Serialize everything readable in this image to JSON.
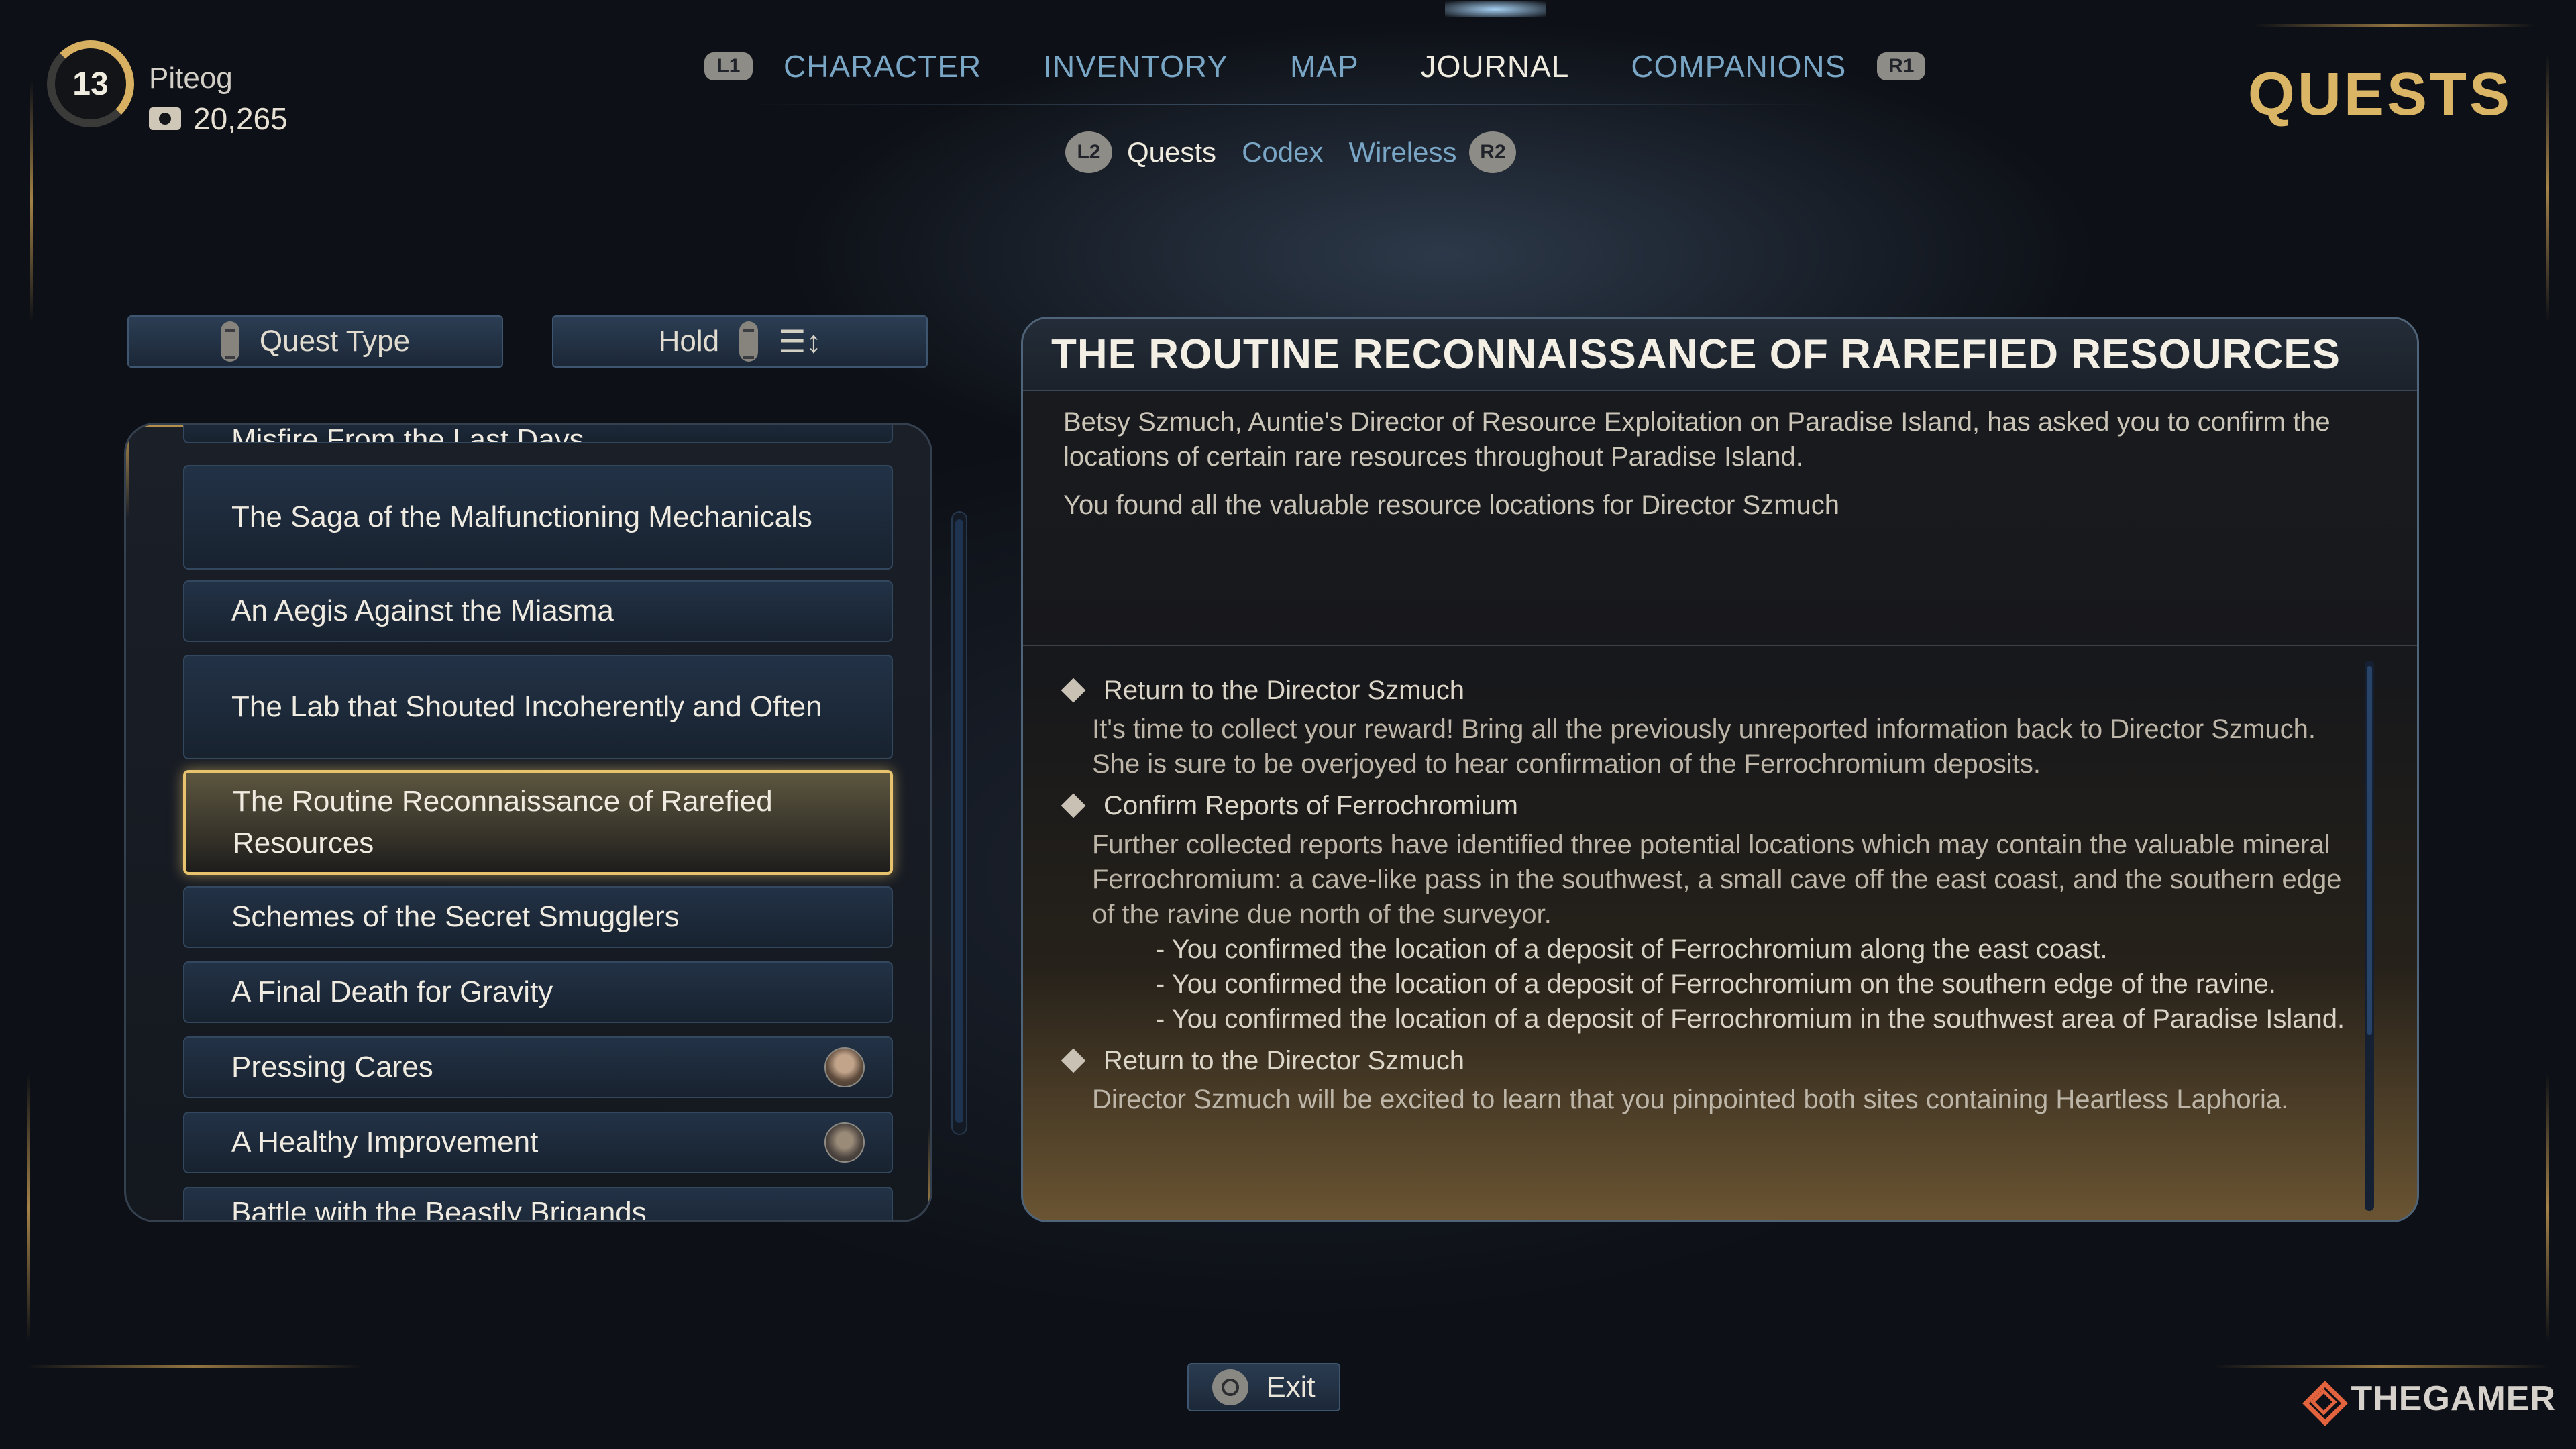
{
  "player": {
    "level": "13",
    "name": "Piteog",
    "credits": "20,265"
  },
  "nav": {
    "left_hint": "L1",
    "right_hint": "R1",
    "tabs": [
      "CHARACTER",
      "INVENTORY",
      "MAP",
      "JOURNAL",
      "COMPANIONS"
    ],
    "active_tab": "JOURNAL"
  },
  "subnav": {
    "left_hint": "L2",
    "right_hint": "R2",
    "tabs": [
      "Quests",
      "Codex",
      "Wireless"
    ],
    "active_tab": "Quests"
  },
  "page_title": "QUESTS",
  "filters": {
    "quest_type_label": "Quest Type",
    "hold_label": "Hold"
  },
  "quest_list": {
    "items": [
      "Misfire From the Last Days",
      "The Saga of the Malfunctioning Mechanicals",
      "An Aegis Against the Miasma",
      "The Lab that Shouted Incoherently and Often",
      "The Routine Reconnaissance of Rarefied Resources",
      "Schemes of the Secret Smugglers",
      "A Final Death for Gravity",
      "Pressing Cares",
      "A Healthy Improvement",
      "Battle with the Beastly Brigands"
    ],
    "selected_index": 4
  },
  "detail": {
    "title": "THE ROUTINE RECONNAISSANCE OF RAREFIED RESOURCES",
    "summary": "Betsy Szmuch, Auntie's Director of Resource Exploitation on Paradise Island, has asked you to confirm the locations of certain rare resources throughout Paradise Island.",
    "progress": "You found all the valuable resource locations for Director Szmuch",
    "objectives": [
      {
        "title": "Return to the Director Szmuch",
        "description": "It's time to collect your reward! Bring all the previously unreported information back to Director Szmuch. She is sure to be overjoyed to hear confirmation of the Ferrochromium deposits."
      },
      {
        "title": "Confirm Reports of Ferrochromium",
        "description": "Further collected reports have identified three potential locations which may contain the valuable mineral Ferrochromium: a cave-like pass in the southwest, a small cave off the east coast, and the southern edge of the ravine due north of the surveyor.",
        "sub": [
          "- You confirmed the location of a deposit of Ferrochromium along the east coast.",
          "- You confirmed the location of a deposit of Ferrochromium on the southern edge of the ravine.",
          "- You confirmed the location of a deposit of Ferrochromium in the southwest area of Paradise Island."
        ]
      },
      {
        "title": "Return to the Director Szmuch",
        "description": "Director Szmuch will be excited to learn that you pinpointed both sites containing Heartless Laphoria."
      }
    ]
  },
  "footer": {
    "exit_label": "Exit"
  },
  "watermark": "THEGAMER",
  "colors": {
    "accent_gold": "#d9b565",
    "tab_blue": "#7aa6c6",
    "selected_border": "#e7c36d"
  }
}
